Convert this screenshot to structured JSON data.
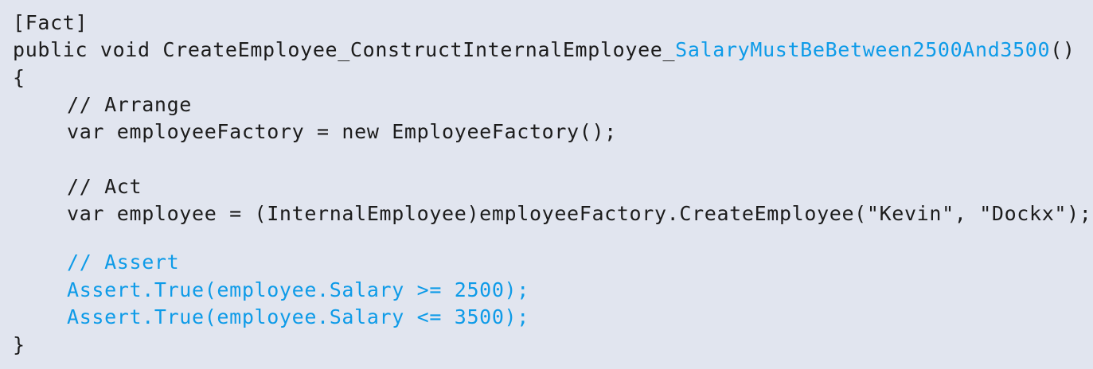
{
  "code": {
    "attribute": "[Fact]",
    "signature_prefix": "public void CreateEmployee_ConstructInternalEmployee_",
    "signature_highlight": "SalaryMustBeBetween2500And3500",
    "signature_suffix": "()",
    "open_brace": "{",
    "comment_arrange": "// Arrange",
    "arrange_statement": "var employeeFactory = new EmployeeFactory();",
    "comment_act": "// Act",
    "act_statement": "var employee = (InternalEmployee)employeeFactory.CreateEmployee(\"Kevin\", \"Dockx\");",
    "comment_assert": "// Assert",
    "assert_line_1": "Assert.True(employee.Salary >= 2500);",
    "assert_line_2": "Assert.True(employee.Salary <= 3500);",
    "close_brace": "}"
  },
  "colors": {
    "background": "#e1e5ef",
    "text": "#1c1c1c",
    "highlight": "#0e9be8"
  }
}
